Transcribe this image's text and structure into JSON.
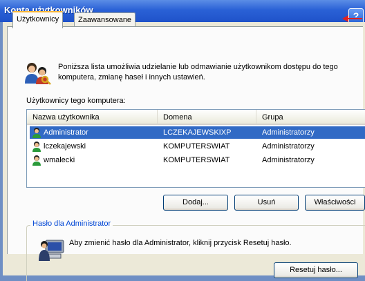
{
  "window": {
    "title": "Konta użytkowników",
    "help_label": "?"
  },
  "tabs": [
    {
      "label": "Użytkownicy",
      "active": true
    },
    {
      "label": "Zaawansowane",
      "active": false
    }
  ],
  "intro_text": "Poniższa lista umożliwia udzielanie lub odmawianie użytkownikom dostępu do tego komputera, zmianę haseł i innych ustawień.",
  "users_list": {
    "label": "Użytkownicy tego komputera:",
    "columns": [
      "Nazwa użytkownika",
      "Domena",
      "Grupa"
    ],
    "rows": [
      {
        "name": "Administrator",
        "domain": "LCZEKAJEWSKIXP",
        "group": "Administratorzy",
        "selected": true
      },
      {
        "name": "lczekajewski",
        "domain": "KOMPUTERSWIAT",
        "group": "Administratorzy",
        "selected": false
      },
      {
        "name": "wmalecki",
        "domain": "KOMPUTERSWIAT",
        "group": "Administratorzy",
        "selected": false
      }
    ]
  },
  "buttons": {
    "add": "Dodaj...",
    "remove": "Usuń",
    "properties": "Właściwości"
  },
  "password_group": {
    "label": "Hasło dla Administrator",
    "text": "Aby zmienić hasło dla Administrator, kliknij przycisk Resetuj hasło.",
    "reset_button": "Resetuj hasło..."
  },
  "colors": {
    "titlebar": "#2a61d6",
    "selection": "#316ac5",
    "arrow": "#e02020",
    "tab_highlight": "#f8b638"
  }
}
